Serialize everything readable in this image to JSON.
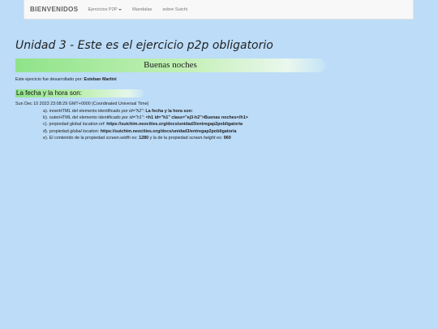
{
  "navbar": {
    "brand": "BIENVENIDOS",
    "items": [
      {
        "label": "Ejercicios P2P",
        "dropdown": true
      },
      {
        "label": "Mandalas"
      },
      {
        "label": "sobre Suichi"
      }
    ]
  },
  "page": {
    "title": "Unidad 3 - Este es el ejercicio p2p obligatorio",
    "h1": "Buenas noches",
    "author_prefix": "Este ejercicio fue desarrollado por:",
    "author_name": "Esteban Martini",
    "h2": "La fecha y la hora son:",
    "datetime": "Sun Dec 10 2023 23:08:29 GMT+0000 (Coordinated Universal Time)"
  },
  "list": {
    "a": {
      "prefix": "a). innerHTML del elemento identificado ",
      "ital": "por id=\"h2\"",
      "mid": ": ",
      "value": "La fecha y la hora son:"
    },
    "b": {
      "prefix": "b). outerHTML del elemento identificado ",
      "ital": "por id=\"h1\"",
      "mid": ": ",
      "value": "<h1 id=\"h1\" class=\"ej3-h2\">Buenas noches</h1>"
    },
    "c": {
      "prefix": "c). propiedad global ",
      "ital": "location.ref",
      "mid": ": ",
      "value": "https://suichim.neocities.org/docs/unidad3/entregap2pobligatoria"
    },
    "d": {
      "prefix": "d). propiedad ",
      "ital": "global location",
      "mid": ": ",
      "value": "https://suichim.neocities.org/docs/unidad3/entregap2pobligatoria"
    },
    "e": {
      "prefix": "e). El contenido de la propiedad ",
      "ital": "screen.width",
      "mid": " es: ",
      "width": "1280",
      "mid2": " y la de la propiedad ",
      "ital2": "screen.height",
      "mid3": " es: ",
      "height": "960"
    }
  },
  "colors": {
    "background": "#bcdcf8",
    "accent_green": "#8fe38a"
  }
}
